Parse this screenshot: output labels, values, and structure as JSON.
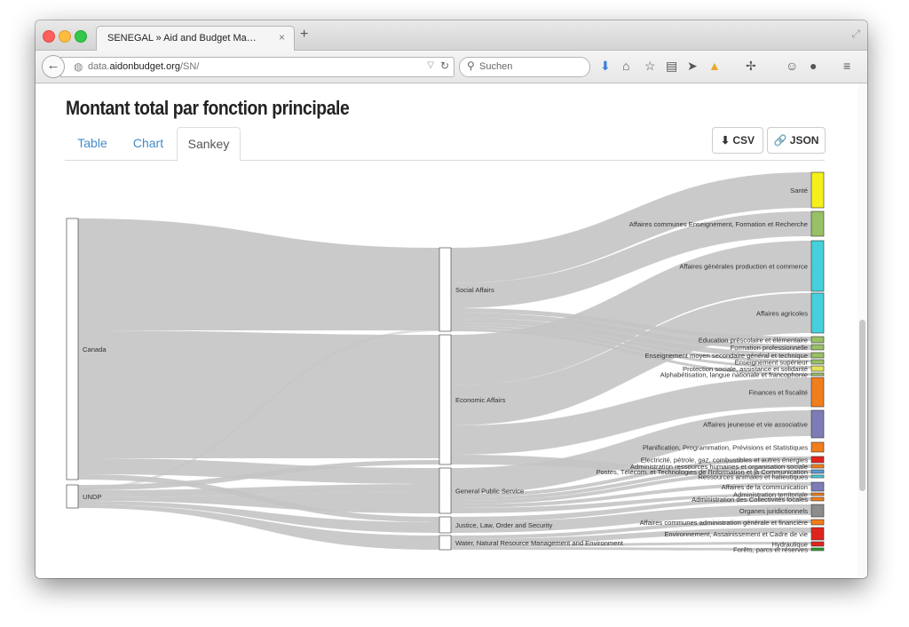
{
  "browser": {
    "tab_title": "SENEGAL » Aid and Budget Ma…",
    "tab_close": "×",
    "new_tab": "+",
    "url_prefix": "data.",
    "url_domain": "aidonbudget.org",
    "url_path": "/SN/",
    "search_placeholder": "Suchen",
    "toolbar_icons": [
      "download-icon",
      "home-icon",
      "bookmark-star-icon",
      "reading-list-icon",
      "send-icon",
      "google-drive-icon",
      "extension-icon",
      "hello-icon",
      "chat-icon",
      "menu-icon"
    ]
  },
  "page": {
    "title": "Montant total par fonction principale",
    "tabs": [
      "Table",
      "Chart",
      "Sankey"
    ],
    "active_tab": "Sankey",
    "csv_label": "CSV",
    "json_label": "JSON"
  },
  "sankey": {
    "sources": [
      {
        "id": "canada",
        "label": "Canada"
      },
      {
        "id": "undp",
        "label": "UNDP"
      }
    ],
    "functions": [
      {
        "id": "social",
        "label": "Social Affairs"
      },
      {
        "id": "economic",
        "label": "Economic Affairs"
      },
      {
        "id": "general",
        "label": "General Public Service"
      },
      {
        "id": "justice",
        "label": "Justice, Law, Order and Security"
      },
      {
        "id": "water",
        "label": "Water, Natural Resource Management and Environment"
      }
    ],
    "subfunctions": [
      {
        "label": "Santé",
        "color": "#f4f01a"
      },
      {
        "label": "Affaires communes Enseignement, Formation et Recherche",
        "color": "#98c065"
      },
      {
        "label": "Affaires générales production et commerce",
        "color": "#45d0dc"
      },
      {
        "label": "Affaires agricoles",
        "color": "#45d0dc"
      },
      {
        "label": "Education préscolaire et élémentaire",
        "color": "#98c065"
      },
      {
        "label": "Formation professionnelle",
        "color": "#98c065"
      },
      {
        "label": "Enseignement moyen secondaire général et technique",
        "color": "#98c065"
      },
      {
        "label": "Enseignement supérieur",
        "color": "#98c065"
      },
      {
        "label": "Protection sociale, assistance et solidarité",
        "color": "#e3e35a"
      },
      {
        "label": "Alphabétisation, langue nationale et francophonie",
        "color": "#98c065"
      },
      {
        "label": "Finances et fiscalité",
        "color": "#f07e1c"
      },
      {
        "label": "Affaires jeunesse et vie associative",
        "color": "#7d7cb7"
      },
      {
        "label": "Planification, Programmation, Prévisions et Statistiques",
        "color": "#f07e1c"
      },
      {
        "label": "Electricité, pétrole, gaz, combustibles et autres énergies",
        "color": "#e0241d"
      },
      {
        "label": "Administration ressources humaines et organisation sociale",
        "color": "#f07e1c"
      },
      {
        "label": "Postes, Télécom. et Technologies de l'Information et la Communication",
        "color": "#5b9bd5"
      },
      {
        "label": "Ressources animales et halieutiques",
        "color": "#45d0dc"
      },
      {
        "label": "Affaires de la communication",
        "color": "#7d7cb7"
      },
      {
        "label": "Administration territoriale",
        "color": "#f07e1c"
      },
      {
        "label": "Administration des Collectivités locales",
        "color": "#f07e1c"
      },
      {
        "label": "Organes juridictionnels",
        "color": "#8c8c8c"
      },
      {
        "label": "Affaires communes administration générale et financière",
        "color": "#f07e1c"
      },
      {
        "label": "Environnement, Assainissement et Cadre de vie",
        "color": "#e0241d"
      },
      {
        "label": "Hydraulique",
        "color": "#e0241d"
      },
      {
        "label": "Forêts, parcs et réserves",
        "color": "#2ca02c"
      }
    ]
  }
}
